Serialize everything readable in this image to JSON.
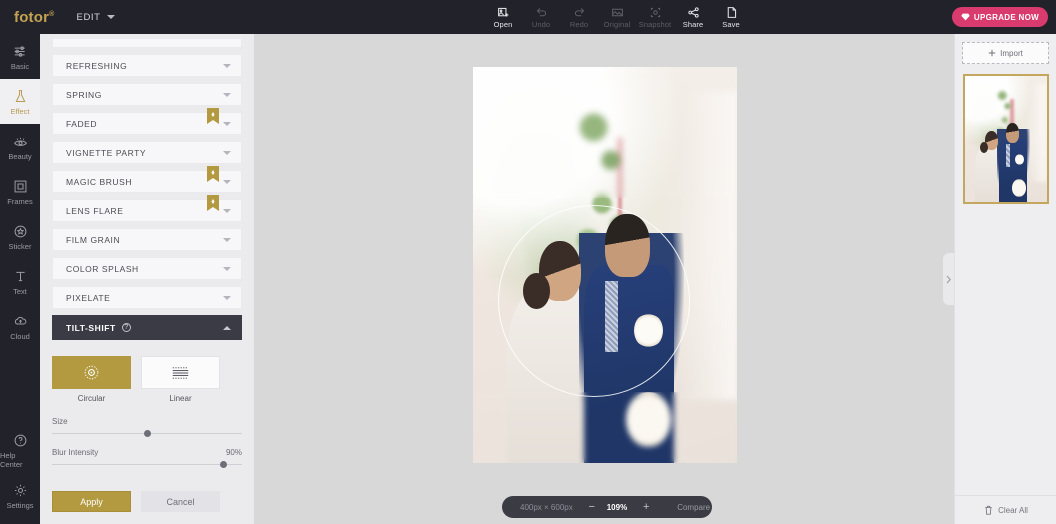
{
  "app": {
    "brand": "fotor",
    "brand_mark": "®",
    "edit_menu": "EDIT",
    "upgrade_label": "UPGRADE NOW",
    "accent_gold": "#b3993f",
    "accent_pink": "#d93b6e",
    "topbar_bg": "#22222b"
  },
  "toolbar": [
    {
      "label": "Open",
      "icon": "open-image-icon",
      "enabled": true
    },
    {
      "label": "Undo",
      "icon": "undo-icon",
      "enabled": false
    },
    {
      "label": "Redo",
      "icon": "redo-icon",
      "enabled": false
    },
    {
      "label": "Original",
      "icon": "original-image-icon",
      "enabled": false
    },
    {
      "label": "Snapshot",
      "icon": "snapshot-icon",
      "enabled": false
    },
    {
      "label": "Share",
      "icon": "share-icon",
      "enabled": true
    },
    {
      "label": "Save",
      "icon": "save-icon",
      "enabled": true
    }
  ],
  "sidebar": {
    "items": [
      {
        "label": "Basic",
        "icon": "sliders-icon",
        "active": false
      },
      {
        "label": "Effect",
        "icon": "flask-icon",
        "active": true
      },
      {
        "label": "Beauty",
        "icon": "eye-icon",
        "active": false
      },
      {
        "label": "Frames",
        "icon": "frame-icon",
        "active": false
      },
      {
        "label": "Sticker",
        "icon": "sticker-star-icon",
        "active": false
      },
      {
        "label": "Text",
        "icon": "text-t-icon",
        "active": false
      },
      {
        "label": "Cloud",
        "icon": "cloud-upload-icon",
        "active": false
      }
    ],
    "bottom_items": [
      {
        "label": "Help Center",
        "icon": "question-circle-icon"
      },
      {
        "label": "Settings",
        "icon": "gear-icon"
      }
    ]
  },
  "effects_panel": {
    "categories": [
      {
        "label": "REFRESHING",
        "premium": false,
        "expanded": false
      },
      {
        "label": "SPRING",
        "premium": false,
        "expanded": false
      },
      {
        "label": "FADED",
        "premium": true,
        "expanded": false
      },
      {
        "label": "VIGNETTE PARTY",
        "premium": false,
        "expanded": false
      },
      {
        "label": "MAGIC BRUSH",
        "premium": true,
        "expanded": false
      },
      {
        "label": "LENS FLARE",
        "premium": true,
        "expanded": false
      },
      {
        "label": "FILM GRAIN",
        "premium": false,
        "expanded": false
      },
      {
        "label": "COLOR SPLASH",
        "premium": false,
        "expanded": false
      },
      {
        "label": "PIXELATE",
        "premium": false,
        "expanded": false
      },
      {
        "label": "TILT-SHIFT",
        "premium": false,
        "expanded": true,
        "help_icon": "question-circle-icon"
      }
    ],
    "tilt_shift": {
      "modes": [
        {
          "label": "Circular",
          "icon": "circular-tilt-icon",
          "selected": true
        },
        {
          "label": "Linear",
          "icon": "linear-tilt-icon",
          "selected": false
        }
      ],
      "sliders": [
        {
          "label": "Size",
          "value_text": "",
          "percent": 50
        },
        {
          "label": "Blur Intensity",
          "value_text": "90%",
          "percent": 90
        }
      ],
      "apply_label": "Apply",
      "cancel_label": "Cancel"
    }
  },
  "canvas": {
    "collapse_icon": "chevron-right-icon",
    "status": {
      "dimensions": "400px × 600px",
      "zoom_out": "−",
      "zoom_level": "109%",
      "zoom_in": "+",
      "compare": "Compare"
    }
  },
  "right_panel": {
    "import_label": "Import",
    "import_icon": "plus-icon",
    "clear_all_label": "Clear All",
    "clear_all_icon": "trash-icon",
    "thumbnail_alt": "wedding-couple-thumbnail"
  }
}
